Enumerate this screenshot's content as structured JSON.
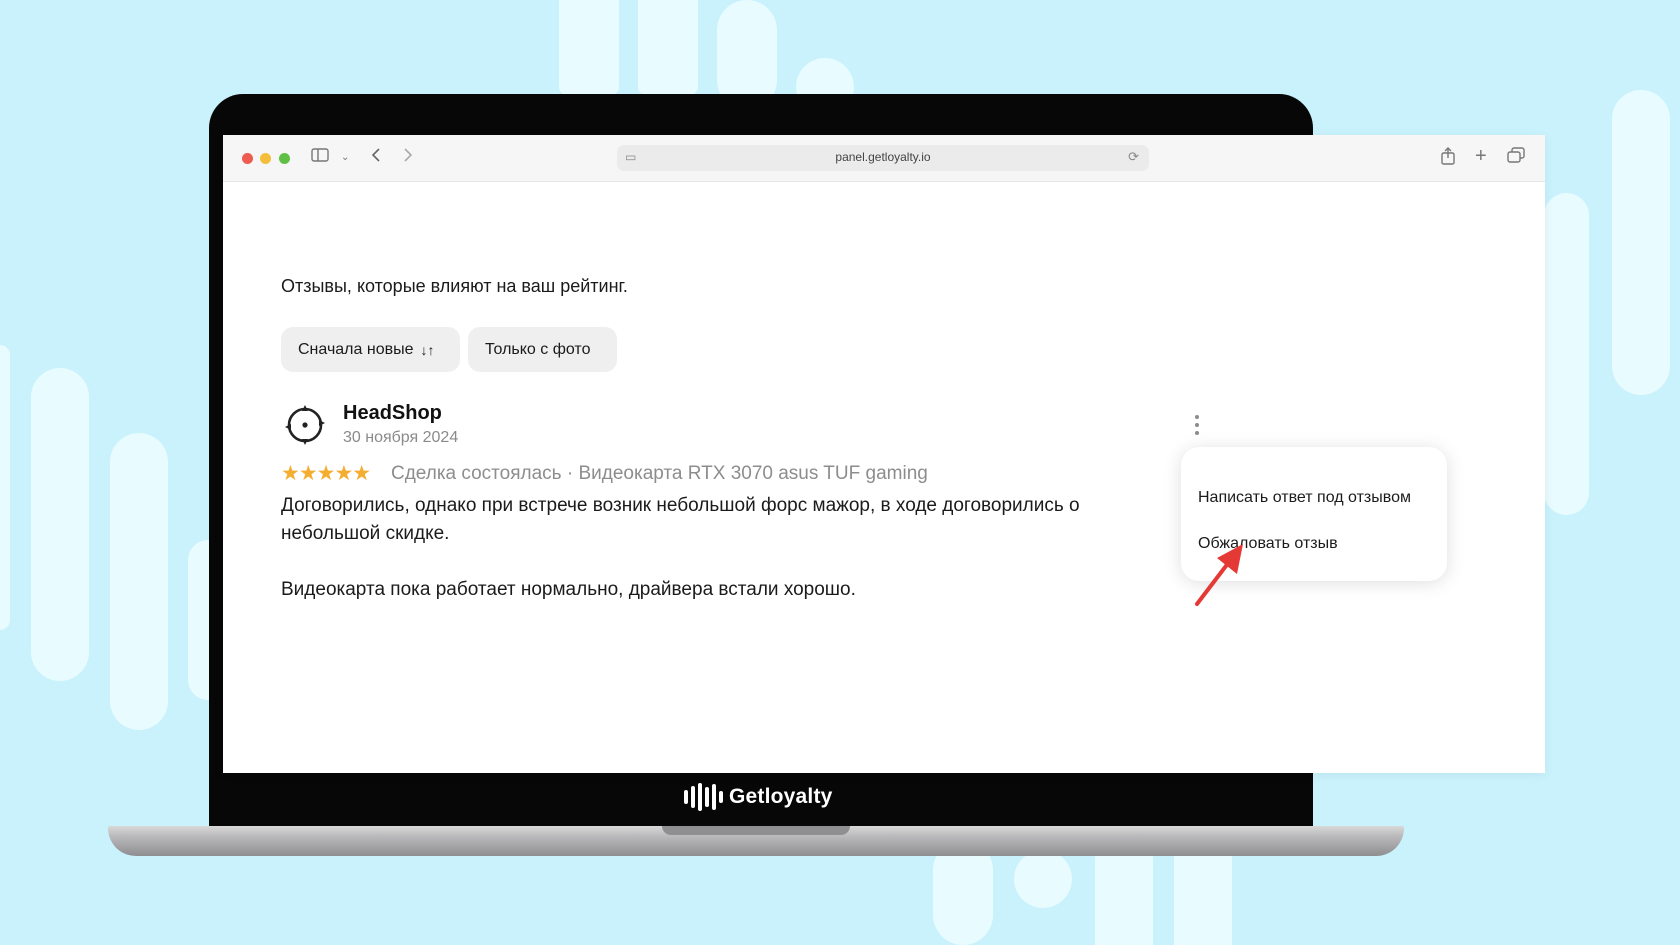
{
  "browser": {
    "url": "panel.getloyalty.io"
  },
  "page": {
    "subtitle": "Отзывы, которые влияют на ваш рейтинг.",
    "filters": {
      "sort_label": "Сначала новые",
      "sort_icon": "sort-arrows-icon",
      "photo_label": "Только с фото"
    }
  },
  "review": {
    "author": "HeadShop",
    "date": "30 ноября 2024",
    "rating": 5,
    "stars": "★★★★★",
    "deal": "Сделка состоялась · Видеокарта RTX 3070 asus TUF gaming",
    "text_1": "Договорились, однако при встрече возник небольшой форс мажор, в ходе договорились о небольшой скидке.",
    "text_2": "Видеокарта пока работает нормально, драйвера встали хорошо."
  },
  "menu": {
    "reply_label": "Написать ответ под отзывом",
    "appeal_label": "Обжаловать отзыв"
  },
  "brand": {
    "name": "Getloyalty"
  },
  "colors": {
    "background": "#c9f2fc",
    "star": "#f4ad2f",
    "arrow": "#e53935"
  }
}
